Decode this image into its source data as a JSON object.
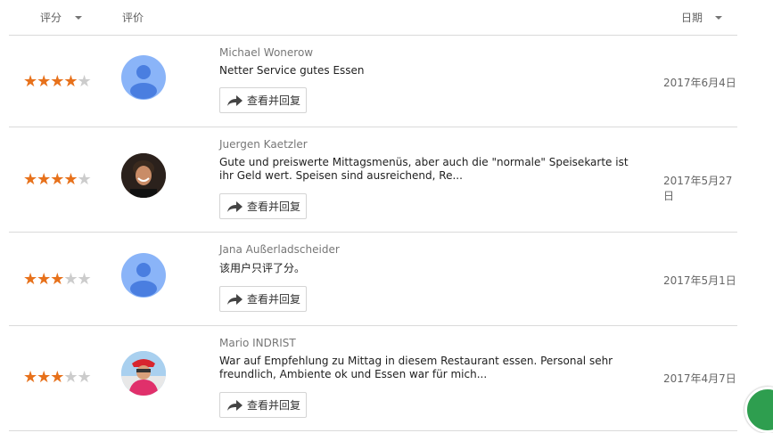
{
  "header": {
    "rating_label": "评分",
    "review_label": "评价",
    "date_label": "日期"
  },
  "reply_label": "查看并回复",
  "reviews": [
    {
      "stars": "★★★★",
      "stars_empty": "★",
      "rating": 4,
      "author": "Michael Wonerow",
      "text": "Netter Service gutes Essen",
      "date": "2017年6月4日",
      "avatar": "default-avatar"
    },
    {
      "stars": "★★★★",
      "stars_empty": "★",
      "rating": 4,
      "author": "Juergen Kaetzler",
      "text": "Gute und preiswerte Mittagsmenüs, aber auch die \"normale\" Speisekarte ist ihr Geld wert. Speisen sind ausreichend, Re...",
      "date": "2017年5月27日",
      "avatar": "photo-avatar"
    },
    {
      "stars": "★★★",
      "stars_empty": "★★",
      "rating": 3,
      "author": "Jana Außerladscheider",
      "text": "该用户只评了分。",
      "date": "2017年5月1日",
      "avatar": "default-avatar"
    },
    {
      "stars": "★★★",
      "stars_empty": "★★",
      "rating": 3,
      "author": "Mario INDRIST",
      "text": "War auf Empfehlung zu Mittag in diesem Restaurant essen. Personal sehr freundlich, Ambiente ok und Essen war für mich...",
      "date": "2017年4月7日",
      "avatar": "photo-avatar"
    }
  ],
  "colors": {
    "star_filled": "#e7711b",
    "star_empty": "#cccccc",
    "avatar_default_bg": "#8ab4f8",
    "avatar_default_fg": "#4a7ee0"
  }
}
